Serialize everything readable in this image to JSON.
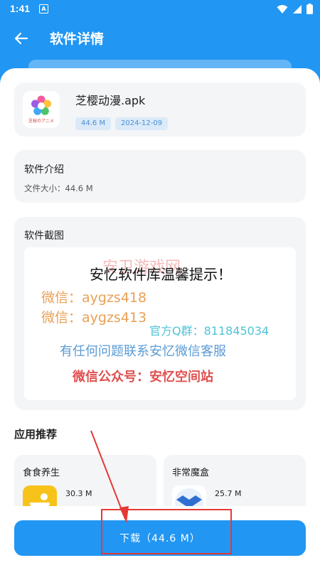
{
  "status": {
    "time": "1:41",
    "notification": "A"
  },
  "header": {
    "title": "软件详情"
  },
  "file": {
    "name": "芝樱动漫.apk",
    "size": "44.6 M",
    "date": "2024-12-09",
    "icon_text": "芝桜のアニメ"
  },
  "intro": {
    "title": "软件介绍",
    "file_size_label": "文件大小：44.6 M"
  },
  "screenshots": {
    "title": "软件截图",
    "image_lines": {
      "watermark": "安卫游戏网",
      "headline": "安忆软件库温馨提示！",
      "wechat1": "微信：aygzs418",
      "wechat2": "微信：aygzs413",
      "qq": "官方Q群：811845034",
      "service": "有任何问题联系安忆微信客服",
      "public": "微信公众号：安忆空间站"
    }
  },
  "recommend": {
    "title": "应用推荐",
    "items": [
      {
        "name": "食食养生",
        "size": "30.3 M",
        "icon": "food-bowl-icon"
      },
      {
        "name": "非常魔盒",
        "size": "25.7 M",
        "icon": "dropbox-icon"
      }
    ]
  },
  "download": {
    "label": "下载（44.6 M）"
  },
  "colors": {
    "primary": "#2196F3",
    "chip_bg": "#dbeaf8",
    "highlight": "#e53935"
  }
}
